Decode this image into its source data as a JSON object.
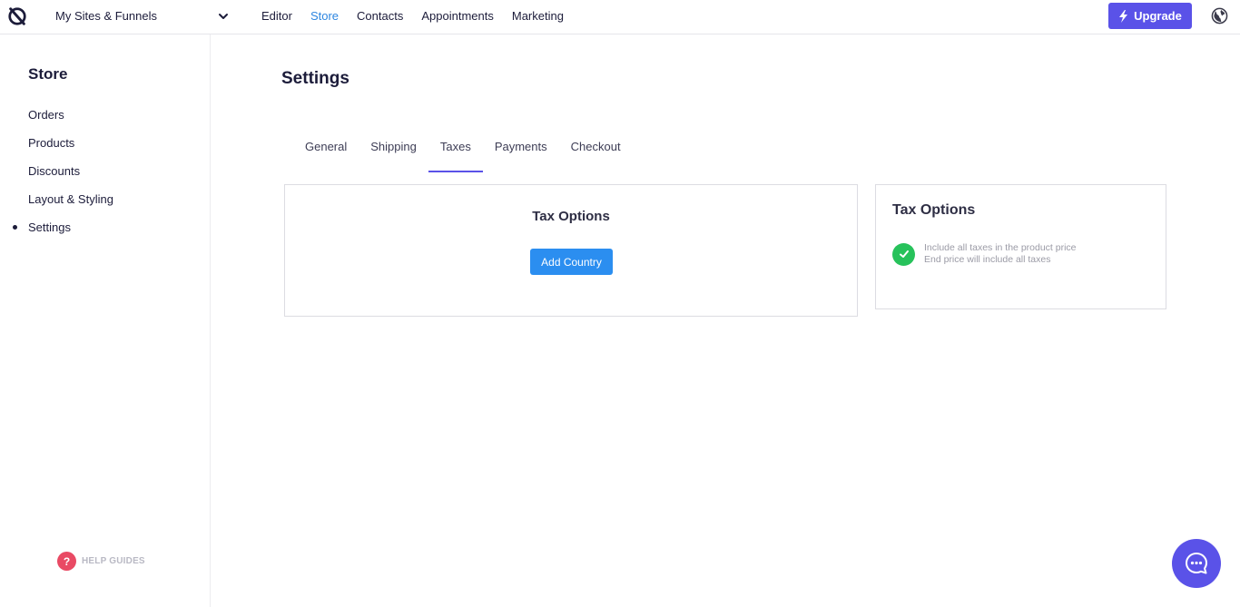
{
  "topbar": {
    "site_selector": "My Sites & Funnels",
    "nav": [
      "Editor",
      "Store",
      "Contacts",
      "Appointments",
      "Marketing"
    ],
    "active_nav": "Store",
    "upgrade_label": "Upgrade"
  },
  "sidebar": {
    "title": "Store",
    "items": [
      "Orders",
      "Products",
      "Discounts",
      "Layout & Styling",
      "Settings"
    ],
    "active_item": "Settings",
    "help_label": "HELP GUIDES"
  },
  "main": {
    "title": "Settings",
    "tabs": [
      "General",
      "Shipping",
      "Taxes",
      "Payments",
      "Checkout"
    ],
    "active_tab": "Taxes",
    "left_card": {
      "title": "Tax Options",
      "button_label": "Add Country"
    },
    "right_card": {
      "title": "Tax Options",
      "option_line1": "Include all taxes in the product price",
      "option_line2": "End price will include all taxes",
      "option_checked": true
    }
  },
  "colors": {
    "accent": "#5a52e8",
    "link_active": "#2d86e0",
    "primary_button": "#2b8ef0",
    "check": "#27c25b",
    "help": "#e94a64"
  },
  "icons": [
    "logo-icon",
    "chevron-down-icon",
    "lightning-icon",
    "globe-icon",
    "help-icon",
    "check-icon",
    "chat-icon"
  ]
}
